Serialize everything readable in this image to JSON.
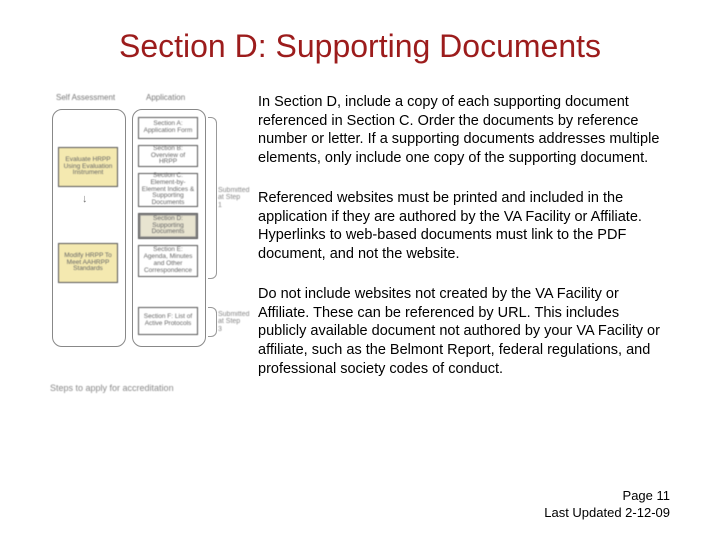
{
  "title": "Section D: Supporting Documents",
  "paragraphs": {
    "p1": "In Section D, include a copy of each supporting document referenced in Section C.  Order the documents by reference number or letter. If a supporting documents addresses multiple elements, only include one copy of the supporting document.",
    "p2": "Referenced websites must be printed and included in the application if they are authored by the VA Facility or Affiliate.  Hyperlinks to web-based documents must link to the PDF document, and not the website.",
    "p3": "Do not include websites not created by the VA Facility or Affiliate.  These can be referenced by URL.  This includes publicly available document not authored by your VA Facility or affiliate, such as the Belmont Report, federal regulations, and professional society codes of conduct."
  },
  "footer": {
    "page": "Page 11",
    "updated": "Last Updated 2-12-09"
  },
  "diagram": {
    "headerA": "Self Assessment",
    "headerB": "Application",
    "colA1": "Evaluate HRPP Using Evaluation Instrument",
    "colA2": "Modify HRPP To Meet AAHRPP Standards",
    "colB1": "Section A: Application Form",
    "colB2": "Section B: Overview of HRPP",
    "colB3": "Section C: Element-by-Element Indices & Supporting Documents",
    "colB4": "Section D: Supporting Documents",
    "colB5": "Section E: Agenda, Minutes and Other Correspondence",
    "colB6": "Section F: List of Active Protocols",
    "side1": "Submitted at Step 1",
    "side2": "Submitted at Step 3",
    "caption": "Steps to apply for accreditation"
  }
}
